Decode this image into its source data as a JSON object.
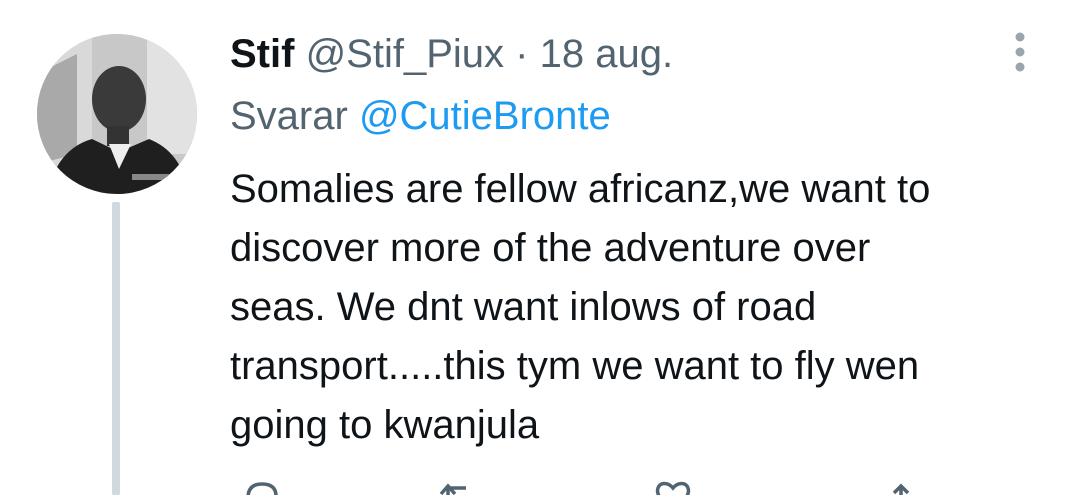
{
  "tweet": {
    "display_name": "Stif",
    "handle": "@Stif_Piux",
    "separator": "·",
    "date": "18 aug.",
    "reply_prefix": "Svarar",
    "reply_to": "@CutieBronte",
    "text_lines": [
      "Somalies are fellow africanz,we want to",
      "discover more of the adventure over",
      "seas. We dnt want inlows of road",
      "transport.....this tym we want to fly wen",
      "going to kwanjula"
    ]
  },
  "icons": {
    "avatar": "profile-photo",
    "more": "more-vertical-icon",
    "actions": [
      "reply-icon",
      "retweet-icon",
      "like-icon",
      "share-icon"
    ]
  },
  "colors": {
    "text": "#0f1419",
    "secondary": "#536471",
    "link": "#1d9bf0",
    "thread_line": "#cfd9de"
  }
}
